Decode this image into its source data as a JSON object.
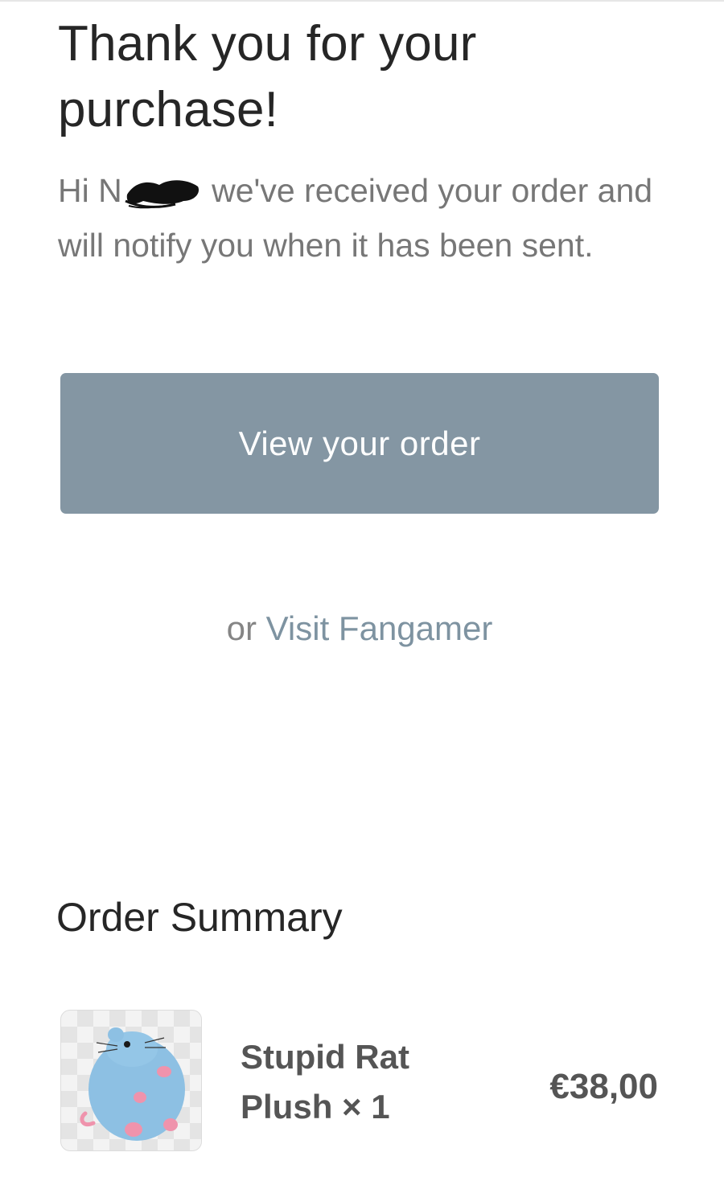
{
  "header": {
    "title": "Thank you for your purchase!"
  },
  "message": {
    "greeting_prefix": "Hi N",
    "greeting_suffix": " we've received your order and will notify you when it has been sent."
  },
  "actions": {
    "view_order_label": "View your order",
    "or_text": "or",
    "visit_store_label": "Visit Fangamer"
  },
  "order_summary": {
    "heading": "Order Summary",
    "items": [
      {
        "name": "Stupid Rat Plush",
        "quantity_text": "× 1",
        "price": "€38,00",
        "thumbnail_icon": "rat-plush-thumbnail"
      }
    ]
  },
  "colors": {
    "button_bg": "#8496a3",
    "link": "#7e93a1",
    "body_text": "#777777",
    "heading_text": "#262626"
  }
}
